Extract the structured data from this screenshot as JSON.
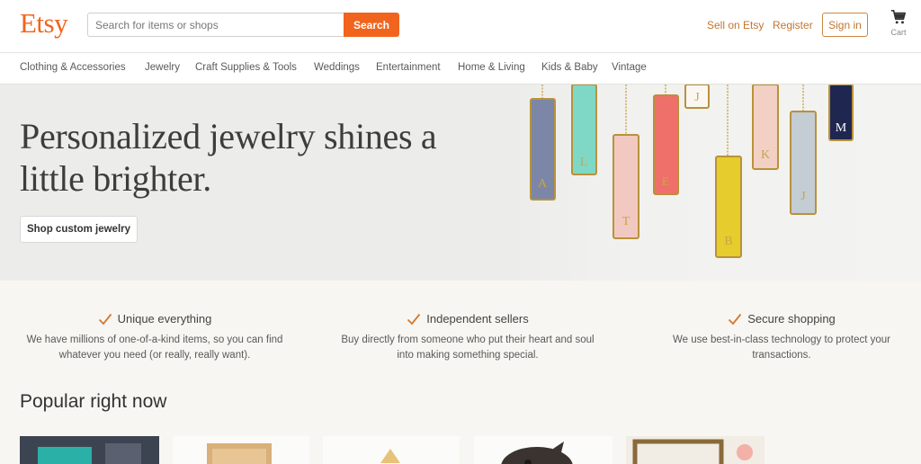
{
  "header": {
    "logo": "Etsy",
    "search": {
      "placeholder": "Search for items or shops",
      "button_label": "Search"
    },
    "sell_link": "Sell on Etsy",
    "register_link": "Register",
    "signin_label": "Sign in",
    "cart_label": "Cart"
  },
  "nav": {
    "items": [
      {
        "label": "Clothing & Accessories"
      },
      {
        "label": "Jewelry"
      },
      {
        "label": "Craft Supplies & Tools"
      },
      {
        "label": "Weddings"
      },
      {
        "label": "Entertainment"
      },
      {
        "label": "Home & Living"
      },
      {
        "label": "Kids & Baby"
      },
      {
        "label": "Vintage"
      }
    ]
  },
  "hero": {
    "title": "Personalized jewelry shines a little brighter.",
    "button_label": "Shop custom jewelry",
    "pendant_letters": [
      "A",
      "L",
      "T",
      "E",
      "J",
      "B",
      "K",
      "J",
      "M"
    ]
  },
  "value_props": [
    {
      "title": "Unique everything",
      "description": "We have millions of one-of-a-kind items, so you can find whatever you need (or really, really want)."
    },
    {
      "title": "Independent sellers",
      "description": "Buy directly from someone who put their heart and soul into making something special."
    },
    {
      "title": "Secure shopping",
      "description": "We use best-in-class technology to protect your transactions."
    }
  ],
  "popular": {
    "title": "Popular right now"
  },
  "colors": {
    "brand": "#f1641e",
    "link": "#c3752f",
    "hero_bg": "#ececea",
    "section_bg": "#f7f6f2"
  },
  "icons": {
    "cart": "cart-icon",
    "check": "check-icon"
  }
}
